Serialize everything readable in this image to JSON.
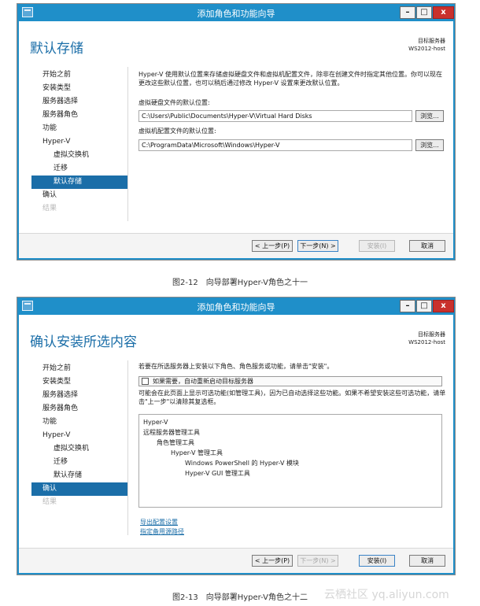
{
  "screen1": {
    "window_title": "添加角色和功能向导",
    "controls": {
      "minimize": "–",
      "maximize": "□",
      "close": "x"
    },
    "page_title": "默认存储",
    "server": {
      "label": "目标服务器",
      "name": "WS2012-host"
    },
    "nav": [
      {
        "label": "开始之前",
        "state": "normal",
        "level": 0
      },
      {
        "label": "安装类型",
        "state": "normal",
        "level": 0
      },
      {
        "label": "服务器选择",
        "state": "normal",
        "level": 0
      },
      {
        "label": "服务器角色",
        "state": "normal",
        "level": 0
      },
      {
        "label": "功能",
        "state": "normal",
        "level": 0
      },
      {
        "label": "Hyper-V",
        "state": "normal",
        "level": 0
      },
      {
        "label": "虚拟交换机",
        "state": "normal",
        "level": 1
      },
      {
        "label": "迁移",
        "state": "normal",
        "level": 1
      },
      {
        "label": "默认存储",
        "state": "active",
        "level": 1
      },
      {
        "label": "确认",
        "state": "normal",
        "level": 0
      },
      {
        "label": "结果",
        "state": "disabled",
        "level": 0
      }
    ],
    "description": "Hyper-V 使用默认位置来存储虚拟硬盘文件和虚拟机配置文件，除非在创建文件时指定其他位置。你可以现在更改这些默认位置，也可以稍后通过修改 Hyper-V 设置来更改默认位置。",
    "vhd_label": "虚拟硬盘文件的默认位置:",
    "vhd_path": "C:\\Users\\Public\\Documents\\Hyper-V\\Virtual Hard Disks",
    "config_label": "虚拟机配置文件的默认位置:",
    "config_path": "C:\\ProgramData\\Microsoft\\Windows\\Hyper-V",
    "browse_label": "浏览...",
    "buttons": {
      "prev": "< 上一步(P)",
      "next": "下一步(N) >",
      "install": "安装(I)",
      "cancel": "取消"
    },
    "caption": "图2-12　向导部署Hyper-V角色之十一"
  },
  "screen2": {
    "window_title": "添加角色和功能向导",
    "controls": {
      "minimize": "–",
      "maximize": "□",
      "close": "x"
    },
    "page_title": "确认安装所选内容",
    "server": {
      "label": "目标服务器",
      "name": "WS2012-host"
    },
    "nav": [
      {
        "label": "开始之前",
        "state": "normal",
        "level": 0
      },
      {
        "label": "安装类型",
        "state": "normal",
        "level": 0
      },
      {
        "label": "服务器选择",
        "state": "normal",
        "level": 0
      },
      {
        "label": "服务器角色",
        "state": "normal",
        "level": 0
      },
      {
        "label": "功能",
        "state": "normal",
        "level": 0
      },
      {
        "label": "Hyper-V",
        "state": "normal",
        "level": 0
      },
      {
        "label": "虚拟交换机",
        "state": "normal",
        "level": 1
      },
      {
        "label": "迁移",
        "state": "normal",
        "level": 1
      },
      {
        "label": "默认存储",
        "state": "normal",
        "level": 1
      },
      {
        "label": "确认",
        "state": "active",
        "level": 0
      },
      {
        "label": "结果",
        "state": "disabled",
        "level": 0
      }
    ],
    "intro": "若要在所选服务器上安装以下角色、角色服务或功能，请单击\"安装\"。",
    "restart_label": "如果需要，自动重新启动目标服务器",
    "restart_checked": false,
    "note": "可能会在此页面上显示可选功能(如管理工具)，因为已自动选择这些功能。如果不希望安装这些可选功能，请单击\"上一步\"以清除其复选框。",
    "items": [
      {
        "label": "Hyper-V",
        "level": 0
      },
      {
        "label": "远程服务器管理工具",
        "level": 0
      },
      {
        "label": "角色管理工具",
        "level": 1
      },
      {
        "label": "Hyper-V 管理工具",
        "level": 2
      },
      {
        "label": "Windows PowerShell 的 Hyper-V 模块",
        "level": 3
      },
      {
        "label": "Hyper-V GUI 管理工具",
        "level": 3
      }
    ],
    "export_link": "导出配置设置",
    "source_link": "指定备用源路径",
    "buttons": {
      "prev": "< 上一步(P)",
      "next": "下一步(N) >",
      "install": "安装(I)",
      "cancel": "取消"
    },
    "caption": "图2-13　向导部署Hyper-V角色之十二"
  },
  "watermark": "云栖社区 yq.aliyun.com"
}
